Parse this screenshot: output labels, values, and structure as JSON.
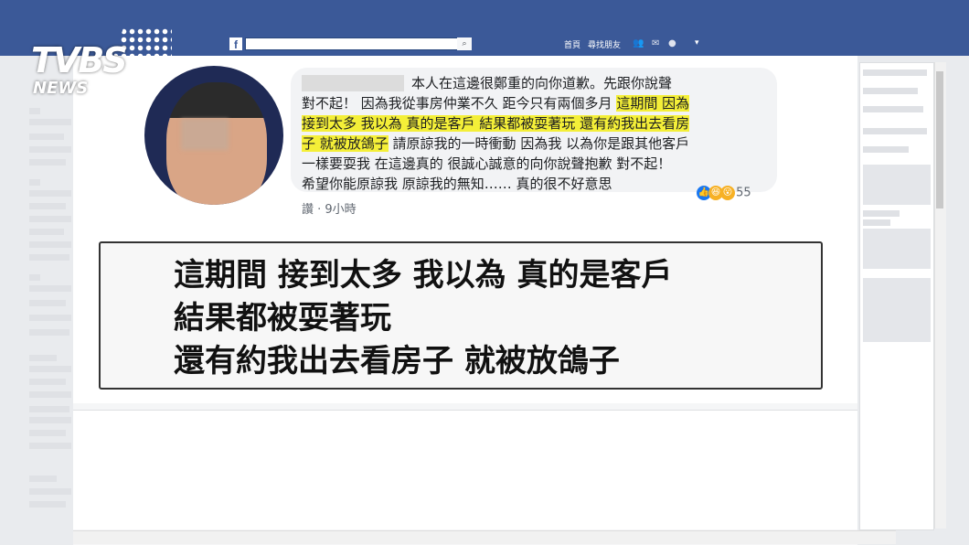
{
  "topbar": {
    "fb_logo": "f",
    "search_placeholder": "",
    "search_btn": "⌕",
    "nav_home": "首頁",
    "nav_friends": "尋找朋友",
    "nav_menu": "▾"
  },
  "brand": {
    "logo_top": "TVBS",
    "logo_bottom": "NEWS"
  },
  "post": {
    "lines": [
      {
        "segs": [
          {
            "t": "本人在這邊很鄭重的向你道歉。先跟你說聲",
            "h": false
          }
        ]
      },
      {
        "segs": [
          {
            "t": "對不起！ 因為我從事房仲業不久  距今只有兩個多月 ",
            "h": false
          },
          {
            "t": "這期間 因為",
            "h": true
          }
        ]
      },
      {
        "segs": [
          {
            "t": "接到太多 我以為 真的是客戶 結果都被耍著玩 還有約我出去看房",
            "h": true
          }
        ]
      },
      {
        "segs": [
          {
            "t": "子 就被放鴿子",
            "h": true
          },
          {
            "t": " 請原諒我的一時衝動 因為我 以為你是跟其他客戶",
            "h": false
          }
        ]
      },
      {
        "segs": [
          {
            "t": "一樣要耍我 在這邊真的 很誠心誠意的向你說聲抱歉 對不起！",
            "h": false
          }
        ]
      },
      {
        "segs": [
          {
            "t": "希望你能原諒我 原諒我的無知……  真的很不好意思",
            "h": false
          }
        ]
      }
    ],
    "reaction_count": "55",
    "meta_time": "讚 · 9小時"
  },
  "caption": {
    "lines": [
      "這期間 接到太多 我以為 真的是客戶",
      "結果都被耍著玩",
      "還有約我出去看房子 就被放鴿子"
    ]
  },
  "colors": {
    "fb_blue": "#3b5998",
    "highlight": "#f4ef38"
  }
}
